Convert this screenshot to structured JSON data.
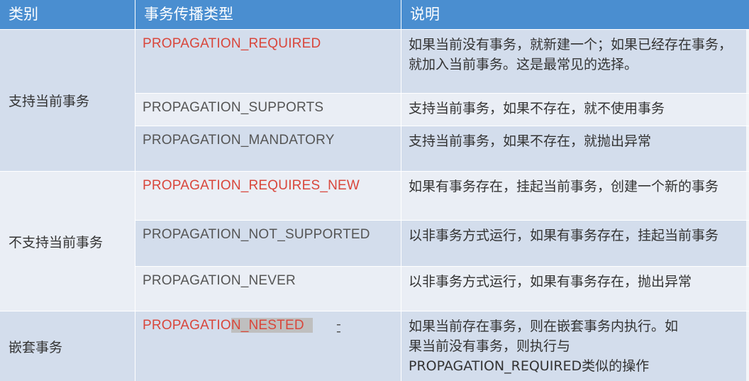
{
  "header": {
    "col1": "类别",
    "col2": "事务传播类型",
    "col3": "说明"
  },
  "groups": [
    {
      "category": "支持当前事务"
    },
    {
      "category": "不支持当前事务"
    },
    {
      "category": "嵌套事务"
    }
  ],
  "rows": [
    {
      "type": "PROPAGATION_REQUIRED",
      "desc": "如果当前没有事务，就新建一个；如果已经存在事务，就加入当前事务。这是最常见的选择。"
    },
    {
      "type": "PROPAGATION_SUPPORTS",
      "desc": "支持当前事务，如果不存在，就不使用事务"
    },
    {
      "type": "PROPAGATION_MANDATORY",
      "desc": "支持当前事务，如果不存在，就抛出异常"
    },
    {
      "type": "PROPAGATION_REQUIRES_NEW",
      "desc": "如果有事务存在，挂起当前事务，创建一个新的事务"
    },
    {
      "type": "PROPAGATION_NOT_SUPPORTED",
      "desc": "以非事务方式运行，如果有事务存在，挂起当前事务"
    },
    {
      "type": "PROPAGATION_NEVER",
      "desc": "以非事务方式运行，如果有事务存在，抛出异常"
    },
    {
      "type_pre": "PROPAGATIO",
      "type_hl": "N_NESTED",
      "desc_line1": "如果当前存在事务，则在嵌套事务内执行。如",
      "desc_line2": "果当前没有事务，则执行与",
      "desc_line3": "PROPAGATION_REQUIRED类似的操作"
    }
  ],
  "marks": {
    "dash": "-"
  },
  "colors": {
    "header": "#4a8ed0",
    "row_dark": "#d3ddec",
    "row_light": "#eaeef5",
    "red_text": "#d9463b"
  }
}
